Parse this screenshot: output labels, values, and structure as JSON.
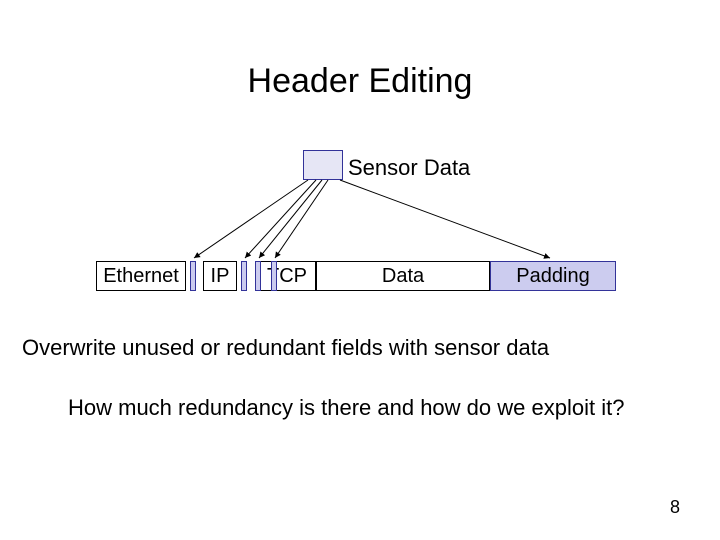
{
  "title": "Header Editing",
  "sensor_label": "Sensor Data",
  "segments": {
    "ethernet": "Ethernet",
    "ip": "IP",
    "tcp": "TCP",
    "data": "Data",
    "padding": "Padding"
  },
  "body": {
    "line1": "Overwrite unused or redundant fields with sensor data",
    "line2": "How much redundancy is there and how do we exploit it?"
  },
  "page_number": "8"
}
